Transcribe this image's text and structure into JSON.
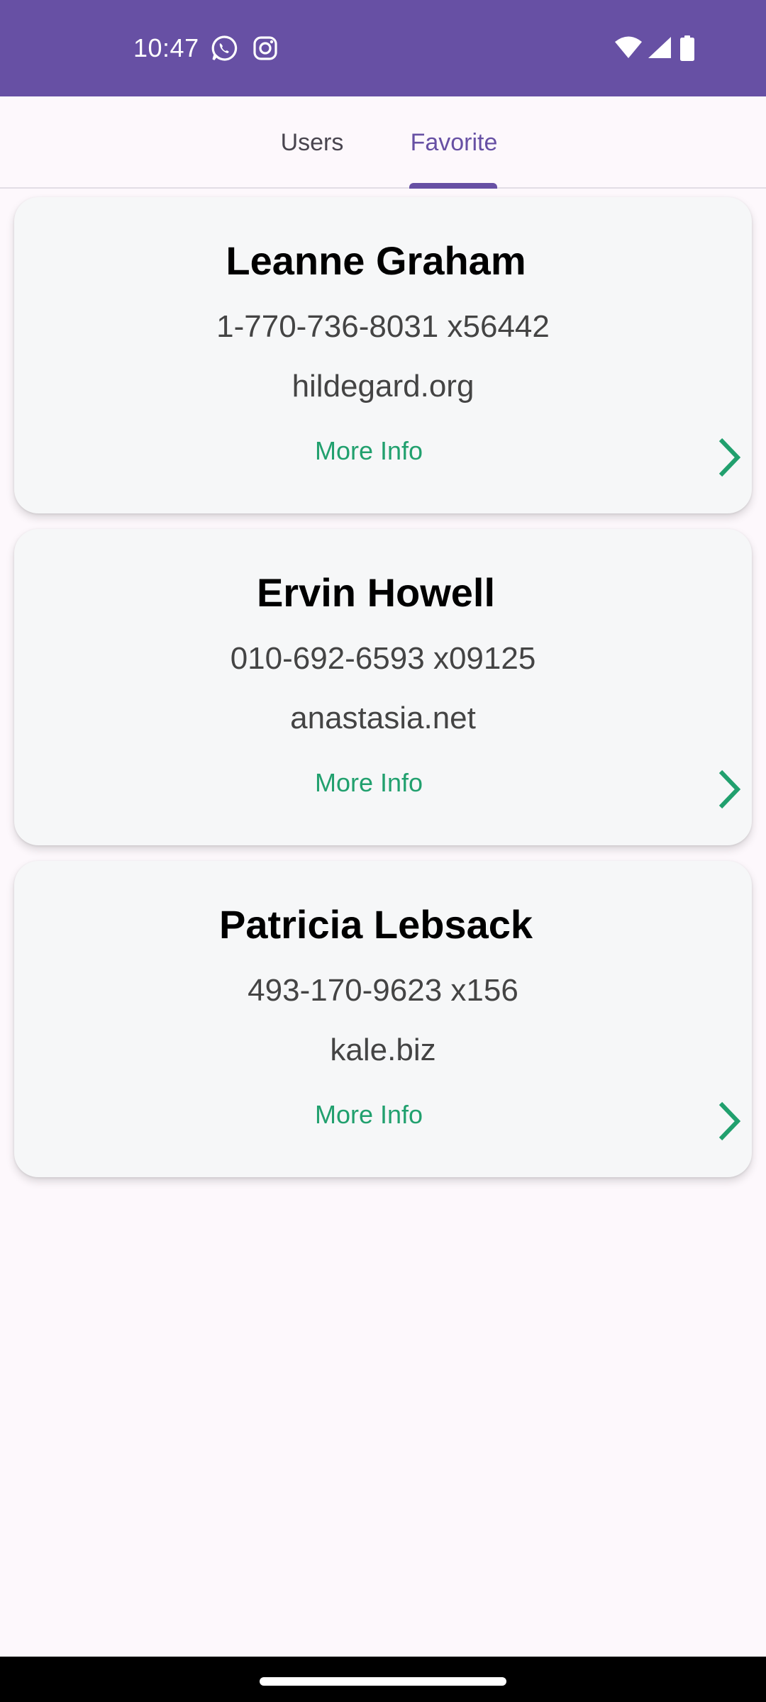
{
  "status_bar": {
    "time": "10:47",
    "app_icons": [
      "whatsapp-icon",
      "instagram-icon"
    ],
    "system_icons": [
      "wifi-icon",
      "signal-icon",
      "battery-icon"
    ]
  },
  "tabs": [
    {
      "label": "Users",
      "selected": false
    },
    {
      "label": "Favorite",
      "selected": true
    }
  ],
  "users": [
    {
      "name": "Leanne Graham",
      "phone": "1-770-736-8031 x56442",
      "website": "hildegard.org",
      "more_label": "More Info"
    },
    {
      "name": "Ervin Howell",
      "phone": "010-692-6593 x09125",
      "website": "anastasia.net",
      "more_label": "More Info"
    },
    {
      "name": "Patricia Lebsack",
      "phone": "493-170-9623 x156",
      "website": "kale.biz",
      "more_label": "More Info"
    }
  ],
  "colors": {
    "primary": "#6750a4",
    "accent_green": "#21a06e",
    "card_background": "#f6f7f8",
    "page_background": "#fdf8fc"
  }
}
